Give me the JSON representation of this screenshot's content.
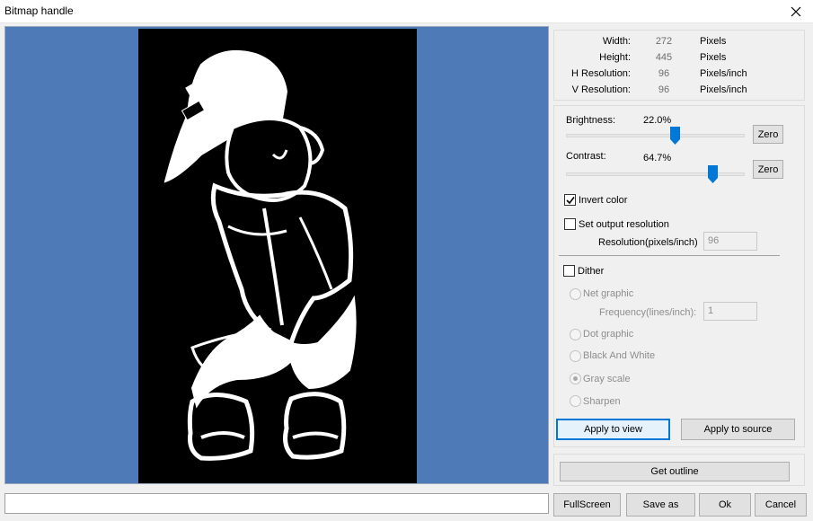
{
  "window": {
    "title": "Bitmap handle",
    "close_icon": "close-icon"
  },
  "info": {
    "rows": [
      {
        "label": "Width:",
        "value": "272",
        "unit": "Pixels"
      },
      {
        "label": "Height:",
        "value": "445",
        "unit": "Pixels"
      },
      {
        "label": "H Resolution:",
        "value": "96",
        "unit": "Pixels/inch"
      },
      {
        "label": "V Resolution:",
        "value": "96",
        "unit": "Pixels/inch"
      }
    ]
  },
  "adjust": {
    "brightness_label": "Brightness:",
    "brightness_value": "22.0%",
    "brightness_level": 0.61,
    "contrast_label": "Contrast:",
    "contrast_value": "64.7%",
    "contrast_level": 0.82,
    "zero_label": "Zero"
  },
  "options": {
    "invert_label": "Invert color",
    "invert_checked": true,
    "output_res_label": "Set output resolution",
    "output_res_checked": false,
    "resolution_label": "Resolution(pixels/inch)",
    "resolution_value": "96",
    "dither_label": "Dither",
    "dither_checked": false,
    "net_graphic_label": "Net graphic",
    "frequency_label": "Frequency(lines/inch):",
    "frequency_value": "1",
    "dot_graphic_label": "Dot graphic",
    "bw_label": "Black And White",
    "gray_label": "Gray scale",
    "sharpen_label": "Sharpen",
    "selected_mode": "Gray scale"
  },
  "actions": {
    "apply_view": "Apply to view",
    "apply_source": "Apply to source",
    "get_outline": "Get outline"
  },
  "footer": {
    "fullscreen": "FullScreen",
    "save_as": "Save as",
    "ok": "Ok",
    "cancel": "Cancel"
  },
  "colors": {
    "preview_bg": "#4e7ab7",
    "slider_thumb": "#0078d7",
    "focus_border": "#0078d7"
  }
}
